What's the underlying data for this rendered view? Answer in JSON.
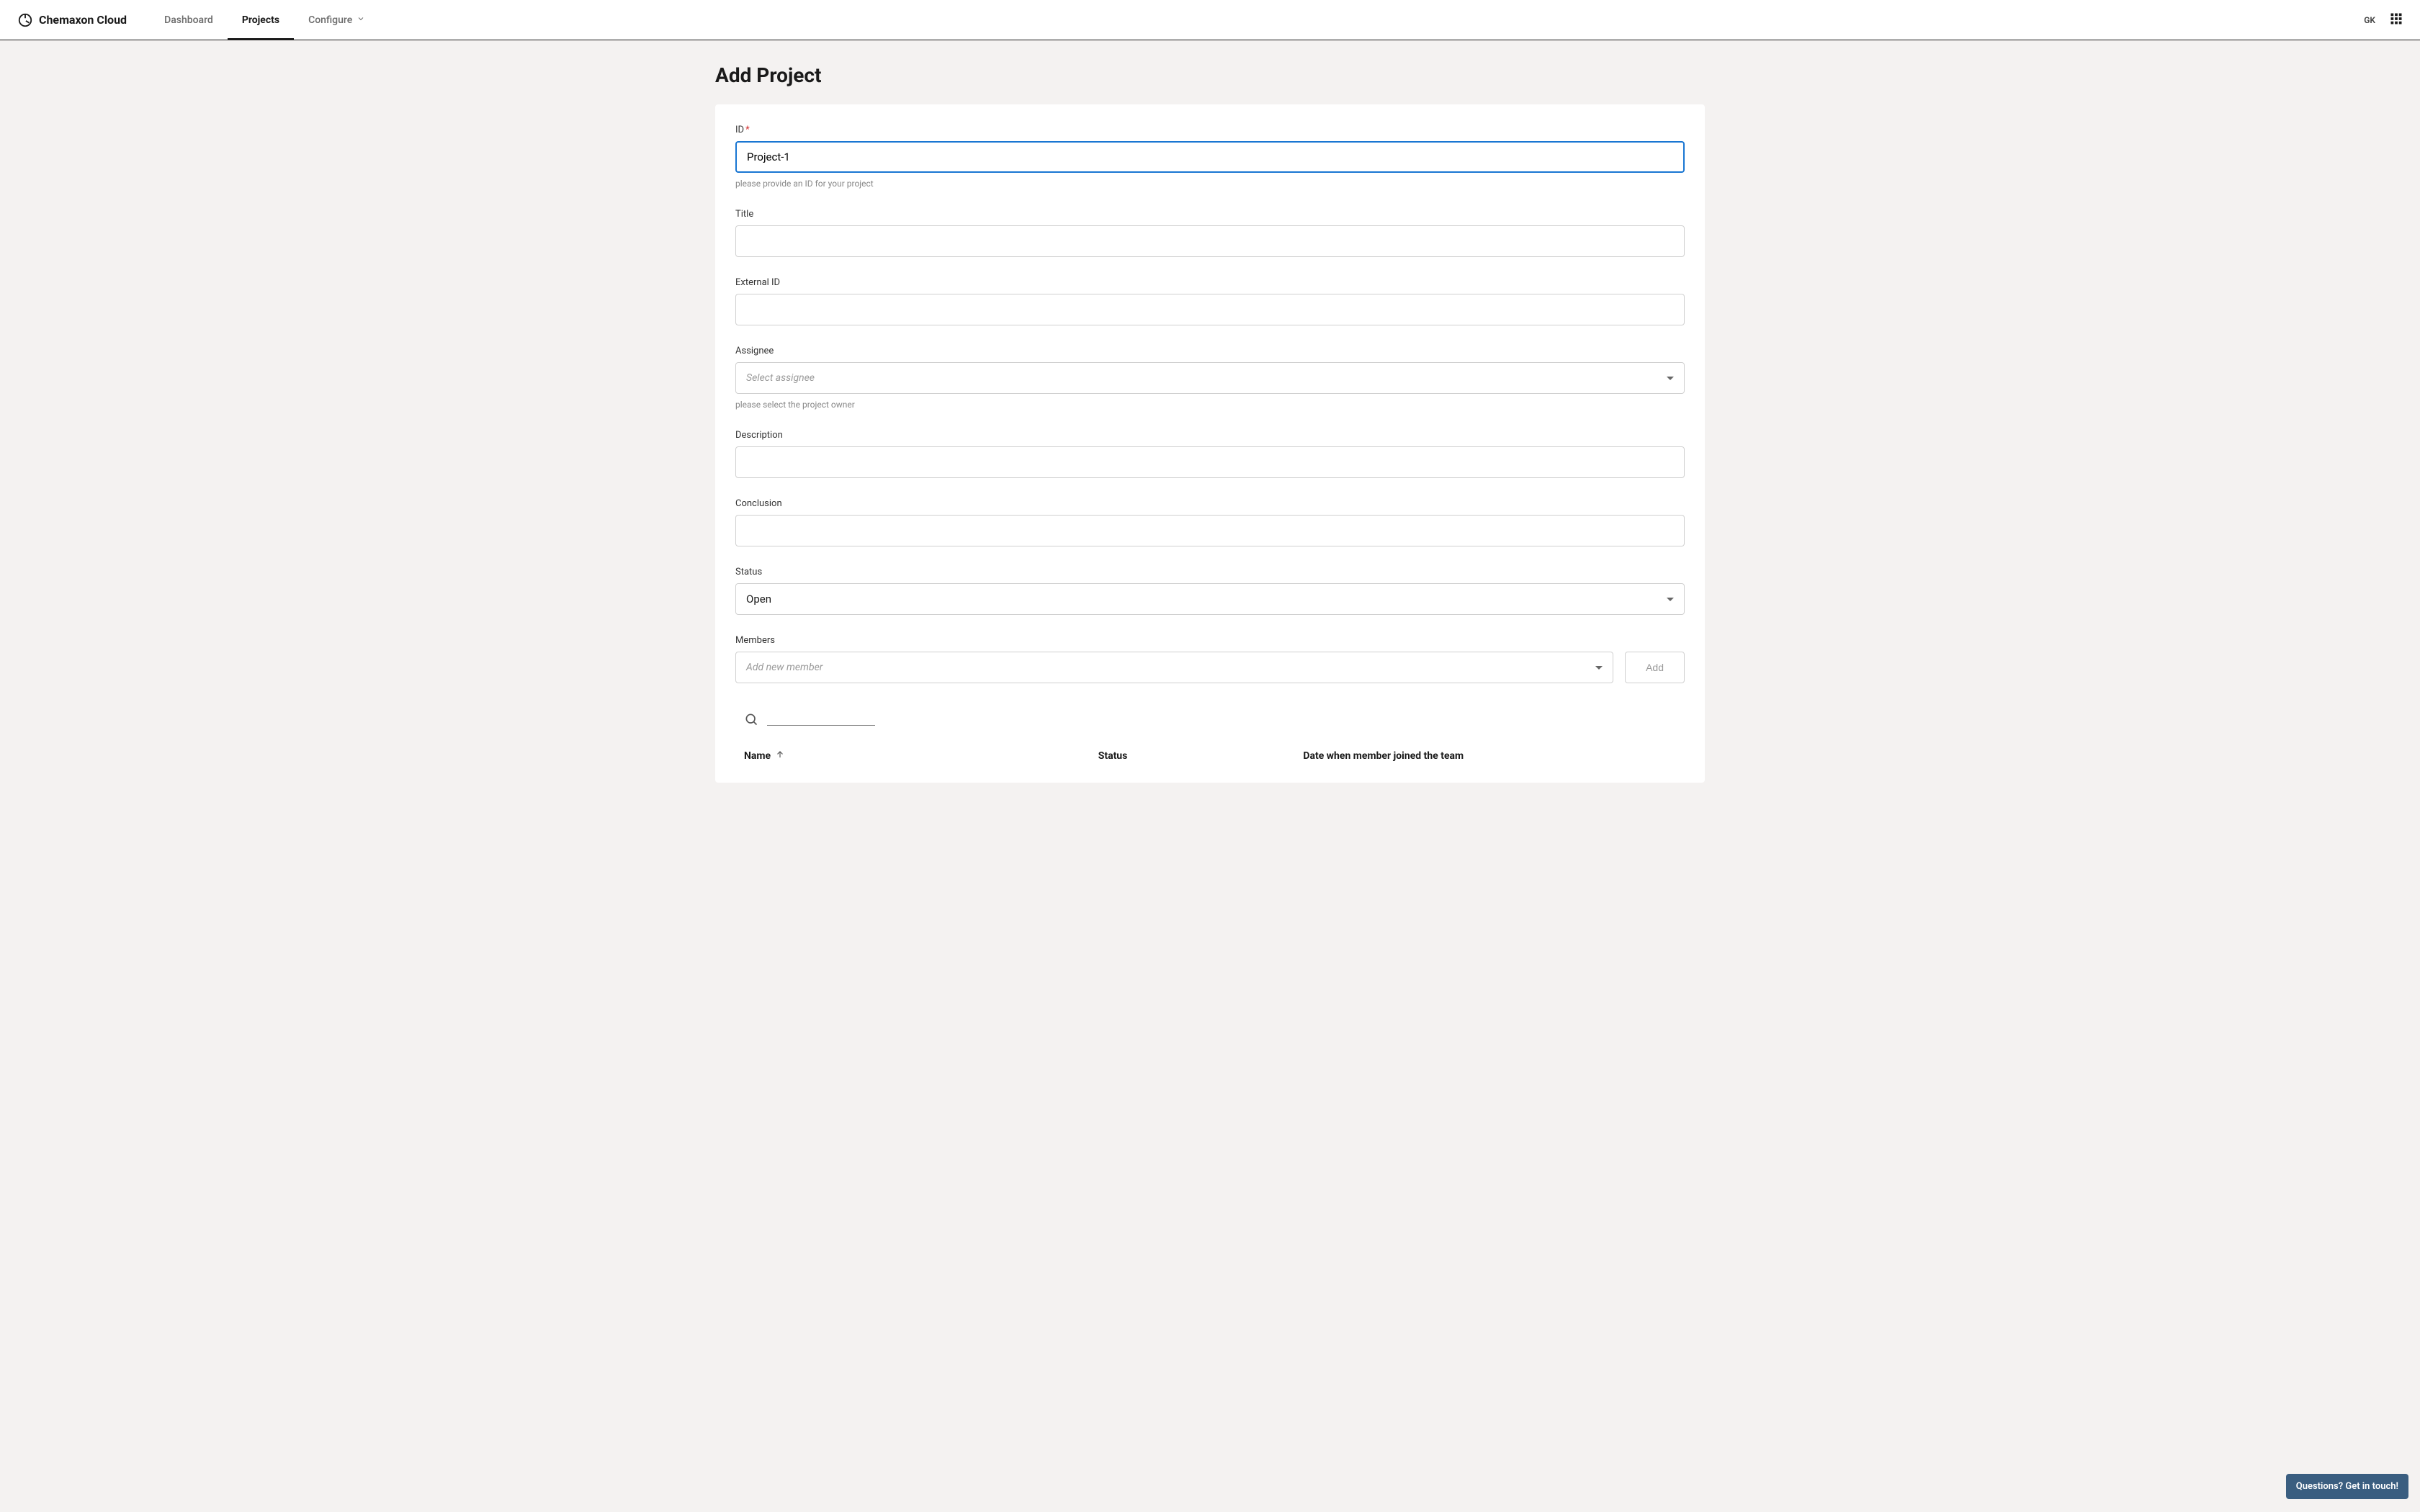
{
  "header": {
    "brand": "Chemaxon Cloud",
    "nav": {
      "dashboard": "Dashboard",
      "projects": "Projects",
      "configure": "Configure"
    },
    "user_initials": "GK"
  },
  "page": {
    "title": "Add Project"
  },
  "form": {
    "id": {
      "label": "ID",
      "value": "Project-1",
      "hint": "please provide an ID for your project"
    },
    "title": {
      "label": "Title",
      "value": ""
    },
    "external_id": {
      "label": "External ID",
      "value": ""
    },
    "assignee": {
      "label": "Assignee",
      "placeholder": "Select assignee",
      "hint": "please select the project owner"
    },
    "description": {
      "label": "Description",
      "value": ""
    },
    "conclusion": {
      "label": "Conclusion",
      "value": ""
    },
    "status": {
      "label": "Status",
      "value": "Open"
    },
    "members": {
      "label": "Members",
      "placeholder": "Add new member",
      "add_button": "Add"
    }
  },
  "table": {
    "columns": {
      "name": "Name",
      "status": "Status",
      "date": "Date when member joined the team"
    }
  },
  "help_button": "Questions? Get in touch!"
}
